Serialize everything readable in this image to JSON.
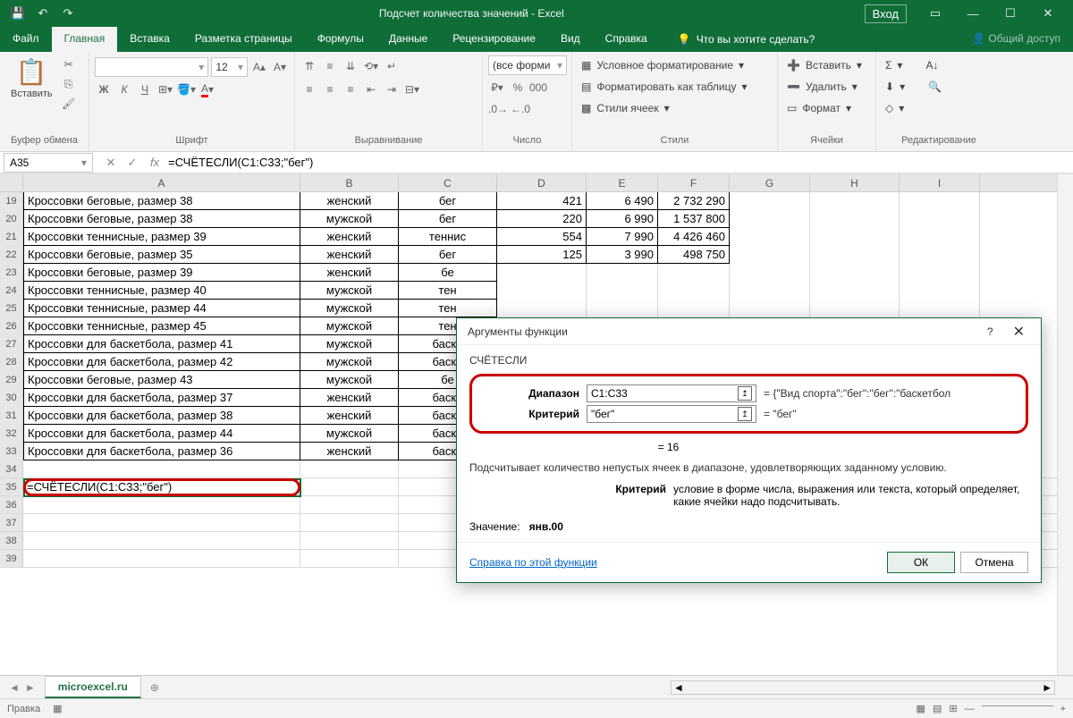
{
  "titlebar": {
    "title": "Подсчет количества значений  -  Excel",
    "login": "Вход"
  },
  "tabs": [
    "Файл",
    "Главная",
    "Вставка",
    "Разметка страницы",
    "Формулы",
    "Данные",
    "Рецензирование",
    "Вид",
    "Справка"
  ],
  "tell": "Что вы хотите сделать?",
  "share": "Общий доступ",
  "ribbon": {
    "clipboard": {
      "paste": "Вставить",
      "label": "Буфер обмена"
    },
    "font": {
      "label": "Шрифт",
      "size": "12"
    },
    "align": {
      "label": "Выравнивание"
    },
    "number": {
      "label": "Число",
      "format": "(все форми"
    },
    "styles": {
      "label": "Стили",
      "cond": "Условное форматирование",
      "table": "Форматировать как таблицу",
      "cell": "Стили ячеек"
    },
    "cells": {
      "label": "Ячейки",
      "insert": "Вставить",
      "delete": "Удалить",
      "format": "Формат"
    },
    "edit": {
      "label": "Редактирование"
    }
  },
  "namebox": "A35",
  "formula": "=СЧЁТЕСЛИ(C1:C33;\"бег\")",
  "cols": [
    "A",
    "B",
    "C",
    "D",
    "E",
    "F",
    "G",
    "H",
    "I"
  ],
  "rows": [
    {
      "n": 19,
      "a": "Кроссовки беговые, размер 38",
      "b": "женский",
      "c": "бег",
      "d": "421",
      "e": "6 490",
      "f": "2 732 290"
    },
    {
      "n": 20,
      "a": "Кроссовки беговые, размер 38",
      "b": "мужской",
      "c": "бег",
      "d": "220",
      "e": "6 990",
      "f": "1 537 800"
    },
    {
      "n": 21,
      "a": "Кроссовки теннисные, размер 39",
      "b": "женский",
      "c": "теннис",
      "d": "554",
      "e": "7 990",
      "f": "4 426 460"
    },
    {
      "n": 22,
      "a": "Кроссовки беговые, размер 35",
      "b": "женский",
      "c": "бег",
      "d": "125",
      "e": "3 990",
      "f": "498 750"
    },
    {
      "n": 23,
      "a": "Кроссовки беговые, размер 39",
      "b": "женский",
      "c": "бе"
    },
    {
      "n": 24,
      "a": "Кроссовки теннисные, размер 40",
      "b": "мужской",
      "c": "тен"
    },
    {
      "n": 25,
      "a": "Кроссовки теннисные, размер 44",
      "b": "мужской",
      "c": "тен"
    },
    {
      "n": 26,
      "a": "Кроссовки теннисные, размер 45",
      "b": "мужской",
      "c": "тен"
    },
    {
      "n": 27,
      "a": "Кроссовки для баскетбола, размер 41",
      "b": "мужской",
      "c": "баске"
    },
    {
      "n": 28,
      "a": "Кроссовки для баскетбола, размер 42",
      "b": "мужской",
      "c": "баске"
    },
    {
      "n": 29,
      "a": "Кроссовки беговые, размер 43",
      "b": "мужской",
      "c": "бе"
    },
    {
      "n": 30,
      "a": "Кроссовки для баскетбола, размер 37",
      "b": "женский",
      "c": "баске"
    },
    {
      "n": 31,
      "a": "Кроссовки для баскетбола, размер 38",
      "b": "женский",
      "c": "баске"
    },
    {
      "n": 32,
      "a": "Кроссовки для баскетбола, размер 44",
      "b": "мужской",
      "c": "баске"
    },
    {
      "n": 33,
      "a": "Кроссовки для баскетбола, размер 36",
      "b": "женский",
      "c": "баске"
    },
    {
      "n": 34
    },
    {
      "n": 35,
      "a": "=СЧЁТЕСЛИ(C1:C33;\"бег\")"
    },
    {
      "n": 36
    },
    {
      "n": 37
    },
    {
      "n": 38
    },
    {
      "n": 39
    }
  ],
  "sheet": "microexcel.ru",
  "status": "Правка",
  "dialog": {
    "title": "Аргументы функции",
    "fn": "СЧЁТЕСЛИ",
    "arg1": {
      "label": "Диапазон",
      "value": "C1:C33",
      "result": "{\"Вид спорта\":\"бег\":\"бег\":\"баскетбол"
    },
    "arg2": {
      "label": "Критерий",
      "value": "\"бег\"",
      "result": "\"бег\""
    },
    "eq": "=  16",
    "desc": "Подсчитывает количество непустых ячеек в диапазоне, удовлетворяющих заданному условию.",
    "krit_l": "Критерий",
    "krit_v": "условие в форме числа, выражения или текста, который определяет, какие ячейки надо подсчитывать.",
    "val_l": "Значение:",
    "val_v": "янв.00",
    "help": "Справка по этой функции",
    "ok": "ОК",
    "cancel": "Отмена"
  }
}
